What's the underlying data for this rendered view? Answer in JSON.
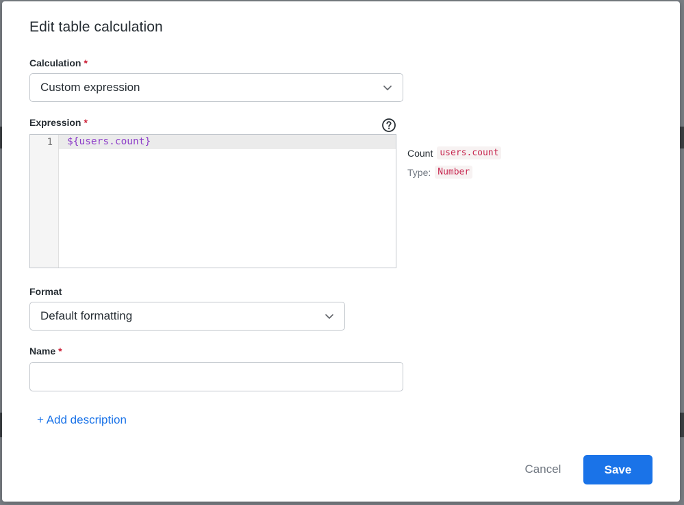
{
  "dialog": {
    "title": "Edit table calculation",
    "calculation": {
      "label": "Calculation",
      "required_mark": "*",
      "value": "Custom expression"
    },
    "expression": {
      "label": "Expression",
      "required_mark": "*",
      "line_number": "1",
      "code": "${users.count}",
      "help_icon": "question-circle-icon"
    },
    "field_info": {
      "name": "Count",
      "field": "users.count",
      "type_label": "Type:",
      "type_value": "Number"
    },
    "format": {
      "label": "Format",
      "value": "Default formatting"
    },
    "name_field": {
      "label": "Name",
      "required_mark": "*",
      "value": "",
      "placeholder": ""
    },
    "add_description": "+ Add description",
    "buttons": {
      "cancel": "Cancel",
      "save": "Save"
    }
  },
  "colors": {
    "accent": "#1a73e8",
    "required": "#cc1f36",
    "code": "#8e3ec9",
    "chip_text": "#c7254e"
  }
}
